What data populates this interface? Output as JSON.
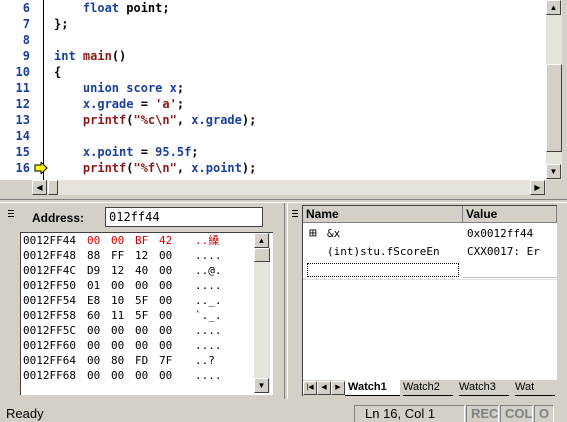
{
  "editor": {
    "lines": [
      {
        "num": "6",
        "text": "    float point;"
      },
      {
        "num": "7",
        "text": "};"
      },
      {
        "num": "8",
        "text": ""
      },
      {
        "num": "9",
        "text": "int main()"
      },
      {
        "num": "10",
        "text": "{"
      },
      {
        "num": "11",
        "text": "    union score x;"
      },
      {
        "num": "12",
        "text": "    x.grade = 'a';"
      },
      {
        "num": "13",
        "text": "    printf(\"%c\\n\", x.grade);"
      },
      {
        "num": "14",
        "text": ""
      },
      {
        "num": "15",
        "text": "    x.point = 95.5f;"
      },
      {
        "num": "16",
        "text": "    printf(\"%f\\n\", x.point);"
      }
    ],
    "current_line": "16"
  },
  "memory": {
    "address_label": "Address:",
    "address_value": "012ff44",
    "rows": [
      {
        "addr": "0012FF44",
        "bytes": [
          "00",
          "00",
          "BF",
          "42"
        ],
        "ascii": "..縔",
        "changed": true
      },
      {
        "addr": "0012FF48",
        "bytes": [
          "88",
          "FF",
          "12",
          "00"
        ],
        "ascii": "....",
        "changed": false
      },
      {
        "addr": "0012FF4C",
        "bytes": [
          "D9",
          "12",
          "40",
          "00"
        ],
        "ascii": "..@.",
        "changed": false
      },
      {
        "addr": "0012FF50",
        "bytes": [
          "01",
          "00",
          "00",
          "00"
        ],
        "ascii": "....",
        "changed": false
      },
      {
        "addr": "0012FF54",
        "bytes": [
          "E8",
          "10",
          "5F",
          "00"
        ],
        "ascii": ".._.",
        "changed": false
      },
      {
        "addr": "0012FF58",
        "bytes": [
          "60",
          "11",
          "5F",
          "00"
        ],
        "ascii": "`._.",
        "changed": false
      },
      {
        "addr": "0012FF5C",
        "bytes": [
          "00",
          "00",
          "00",
          "00"
        ],
        "ascii": "....",
        "changed": false
      },
      {
        "addr": "0012FF60",
        "bytes": [
          "00",
          "00",
          "00",
          "00"
        ],
        "ascii": "....",
        "changed": false
      },
      {
        "addr": "0012FF64",
        "bytes": [
          "00",
          "80",
          "FD",
          "7F"
        ],
        "ascii": "..?",
        "changed": false
      },
      {
        "addr": "0012FF68",
        "bytes": [
          "00",
          "00",
          "00",
          "00"
        ],
        "ascii": "....",
        "changed": false
      }
    ]
  },
  "watch": {
    "col_name": "Name",
    "col_value": "Value",
    "rows": [
      {
        "expander": "⊞",
        "name": "&x",
        "value": "0x0012ff44"
      },
      {
        "expander": "",
        "name": "(int)stu.fScoreEn",
        "value": "CXX0017: Er"
      },
      {
        "expander": "",
        "name": "",
        "value": ""
      }
    ],
    "tabs": [
      "Watch1",
      "Watch2",
      "Watch3",
      "Wat"
    ],
    "active_tab": "Watch1"
  },
  "statusbar": {
    "ready": "Ready",
    "position": "Ln 16, Col 1",
    "rec": "REC",
    "col": "COL",
    "ovr": "O"
  },
  "colors": {
    "keyword": "#1a3fa0",
    "function": "#8b1a1a",
    "changed_memory": "#d40000",
    "chrome": "#d4d0c8"
  }
}
